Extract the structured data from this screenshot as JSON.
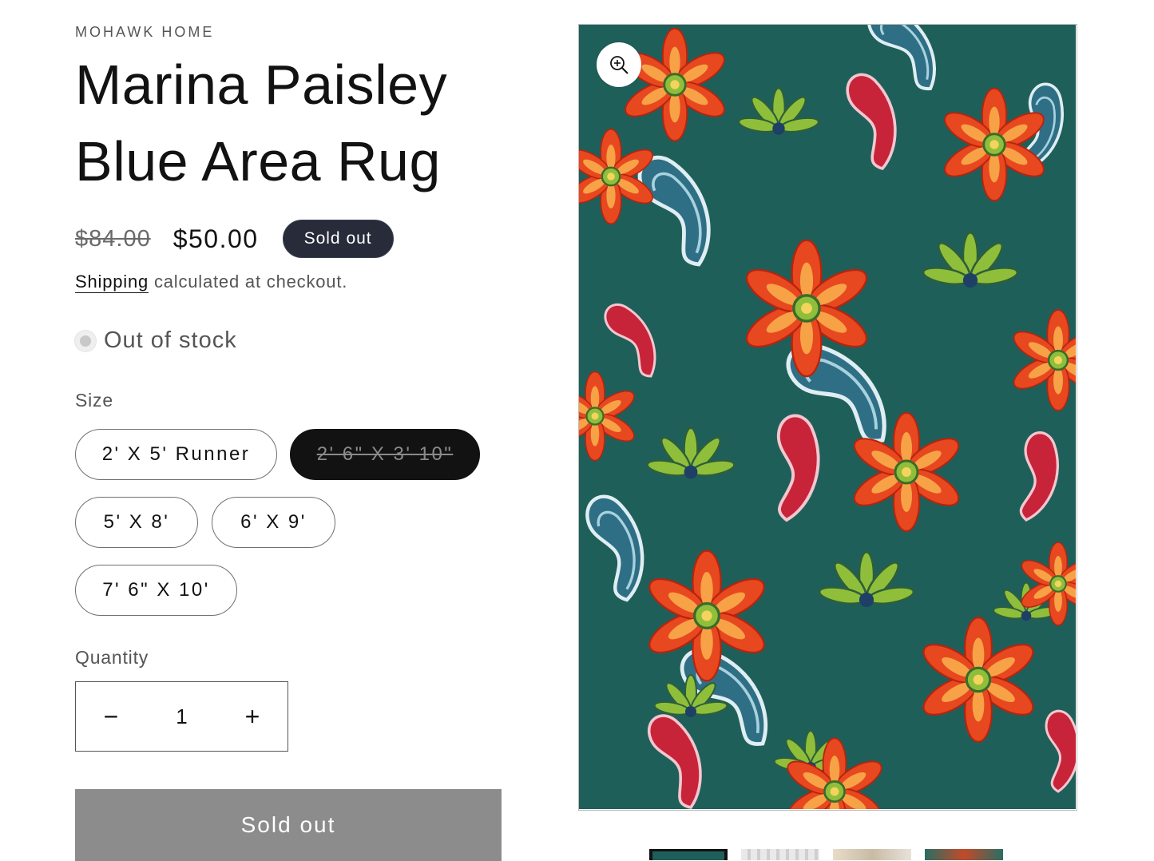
{
  "product": {
    "vendor": "MOHAWK HOME",
    "title_line1": "Marina Paisley",
    "title_line2": "Blue Area Rug",
    "price_regular": "$84.00",
    "price_sale": "$50.00",
    "badge": "Sold out",
    "shipping_link": "Shipping",
    "shipping_text": " calculated at checkout.",
    "stock_status": "Out of stock"
  },
  "size": {
    "label": "Size",
    "options": [
      "2' X 5' Runner",
      "2' 6\" X 3' 10\"",
      "5' X 8'",
      "6' X 9'",
      "7' 6\" X 10'"
    ],
    "selected_index": 1
  },
  "quantity": {
    "label": "Quantity",
    "value": "1",
    "minus": "−",
    "plus": "+"
  },
  "cta": {
    "label": "Sold out"
  },
  "media": {
    "zoom_icon": "magnifier-plus-icon",
    "image_subject": "teal rug with orange flowers and blue paisleys",
    "thumbnail_count": 4,
    "active_thumbnail_index": 0
  },
  "colors": {
    "badge_bg": "#272b3a",
    "cta_bg": "#8c8c8c",
    "rug_teal": "#1f5f5a",
    "rug_orange": "#e8481f",
    "rug_paisley": "#7fb6c9",
    "text": "#121212"
  }
}
